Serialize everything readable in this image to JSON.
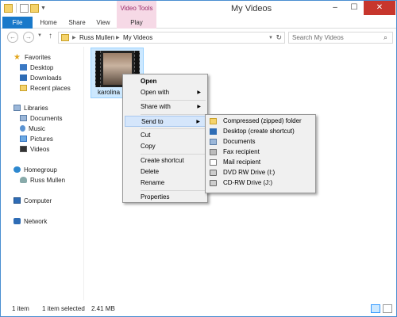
{
  "window": {
    "title": "My Videos",
    "contextual_tab_header": "Video Tools",
    "minimize": "–",
    "maximize": "☐",
    "close": "✕"
  },
  "ribbon": {
    "tabs": [
      "File",
      "Home",
      "Share",
      "View",
      "Play"
    ]
  },
  "address_bar": {
    "crumbs": [
      "Russ Mullen",
      "My Videos"
    ],
    "search_placeholder": "Search My Videos"
  },
  "nav": {
    "favorites": "Favorites",
    "desktop": "Desktop",
    "downloads": "Downloads",
    "recent": "Recent places",
    "libraries": "Libraries",
    "documents": "Documents",
    "music": "Music",
    "pictures": "Pictures",
    "videos": "Videos",
    "homegroup": "Homegroup",
    "russ": "Russ Mullen",
    "computer": "Computer",
    "network": "Network"
  },
  "file": {
    "name": "karolina"
  },
  "context_menu": {
    "open": "Open",
    "open_with": "Open with",
    "share_with": "Share with",
    "send_to": "Send to",
    "cut": "Cut",
    "copy": "Copy",
    "create_shortcut": "Create shortcut",
    "delete": "Delete",
    "rename": "Rename",
    "properties": "Properties"
  },
  "send_to_menu": {
    "zip": "Compressed (zipped) folder",
    "desktop": "Desktop (create shortcut)",
    "documents": "Documents",
    "fax": "Fax recipient",
    "mail": "Mail recipient",
    "dvd": "DVD RW Drive (I:)",
    "cd": "CD-RW Drive (J:)"
  },
  "status": {
    "count": "1 item",
    "selected": "1 item selected",
    "size": "2.41 MB"
  }
}
